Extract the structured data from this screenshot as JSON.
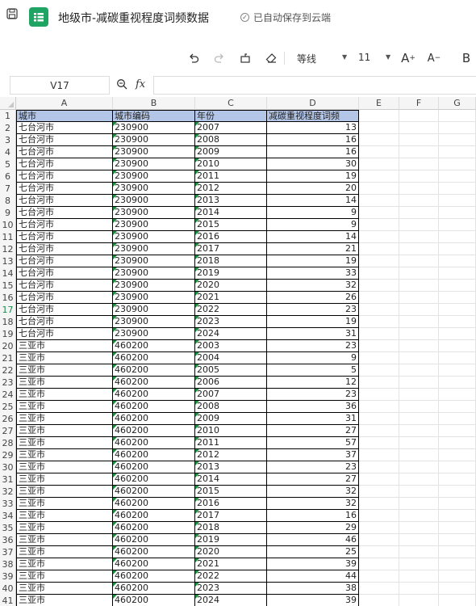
{
  "window": {
    "title": "地级市-减碳重视程度词频数据",
    "autosave_status": "已自动保存到云端"
  },
  "toolbar": {
    "font_name": "等线",
    "font_size": "11",
    "icons": [
      "undo-icon",
      "redo-icon",
      "format-painter-icon",
      "clear-format-icon",
      "increase-font-icon",
      "decrease-font-icon",
      "bold-icon"
    ],
    "increase_font_label": "A",
    "decrease_font_label": "A",
    "bold_label": "B"
  },
  "formula_bar": {
    "cell_ref": "V17",
    "fx_label": "fx",
    "formula": ""
  },
  "grid": {
    "columns": [
      "A",
      "B",
      "C",
      "D",
      "E",
      "F",
      "G"
    ],
    "active_row": 17,
    "header": [
      "城市",
      "城市编码",
      "年份",
      "减碳重视程度词频"
    ],
    "rows": [
      [
        "七台河市",
        "230900",
        "2007",
        "13"
      ],
      [
        "七台河市",
        "230900",
        "2008",
        "16"
      ],
      [
        "七台河市",
        "230900",
        "2009",
        "16"
      ],
      [
        "七台河市",
        "230900",
        "2010",
        "30"
      ],
      [
        "七台河市",
        "230900",
        "2011",
        "19"
      ],
      [
        "七台河市",
        "230900",
        "2012",
        "20"
      ],
      [
        "七台河市",
        "230900",
        "2013",
        "14"
      ],
      [
        "七台河市",
        "230900",
        "2014",
        "9"
      ],
      [
        "七台河市",
        "230900",
        "2015",
        "9"
      ],
      [
        "七台河市",
        "230900",
        "2016",
        "14"
      ],
      [
        "七台河市",
        "230900",
        "2017",
        "21"
      ],
      [
        "七台河市",
        "230900",
        "2018",
        "19"
      ],
      [
        "七台河市",
        "230900",
        "2019",
        "33"
      ],
      [
        "七台河市",
        "230900",
        "2020",
        "32"
      ],
      [
        "七台河市",
        "230900",
        "2021",
        "26"
      ],
      [
        "七台河市",
        "230900",
        "2022",
        "23"
      ],
      [
        "七台河市",
        "230900",
        "2023",
        "19"
      ],
      [
        "七台河市",
        "230900",
        "2024",
        "31"
      ],
      [
        "三亚市",
        "460200",
        "2003",
        "23"
      ],
      [
        "三亚市",
        "460200",
        "2004",
        "9"
      ],
      [
        "三亚市",
        "460200",
        "2005",
        "5"
      ],
      [
        "三亚市",
        "460200",
        "2006",
        "12"
      ],
      [
        "三亚市",
        "460200",
        "2007",
        "23"
      ],
      [
        "三亚市",
        "460200",
        "2008",
        "36"
      ],
      [
        "三亚市",
        "460200",
        "2009",
        "31"
      ],
      [
        "三亚市",
        "460200",
        "2010",
        "27"
      ],
      [
        "三亚市",
        "460200",
        "2011",
        "57"
      ],
      [
        "三亚市",
        "460200",
        "2012",
        "37"
      ],
      [
        "三亚市",
        "460200",
        "2013",
        "23"
      ],
      [
        "三亚市",
        "460200",
        "2014",
        "27"
      ],
      [
        "三亚市",
        "460200",
        "2015",
        "32"
      ],
      [
        "三亚市",
        "460200",
        "2016",
        "32"
      ],
      [
        "三亚市",
        "460200",
        "2017",
        "16"
      ],
      [
        "三亚市",
        "460200",
        "2018",
        "29"
      ],
      [
        "三亚市",
        "460200",
        "2019",
        "46"
      ],
      [
        "三亚市",
        "460200",
        "2020",
        "25"
      ],
      [
        "三亚市",
        "460200",
        "2021",
        "39"
      ],
      [
        "三亚市",
        "460200",
        "2022",
        "44"
      ],
      [
        "三亚市",
        "460200",
        "2023",
        "38"
      ],
      [
        "三亚市",
        "460200",
        "2024",
        "39"
      ]
    ]
  },
  "colors": {
    "header_fill": "#b4c6e7",
    "logo": "#1fa463",
    "text_number_marker": "#1b8a3a"
  }
}
